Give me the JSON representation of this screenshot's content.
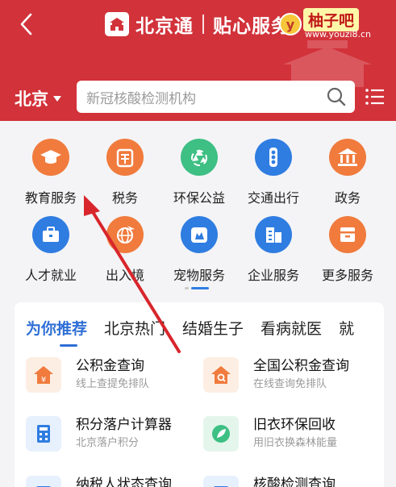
{
  "header": {
    "app_name": "北京通",
    "subtitle": "贴心服务",
    "city": "北京",
    "search_placeholder": "新冠核酸检测机构"
  },
  "watermark": {
    "badge": "y",
    "name": "柚子吧",
    "url": "www.youzi8.cn"
  },
  "grid": {
    "row1": [
      {
        "label": "教育服务",
        "icon": "graduation-cap-icon",
        "color": "#f07b3d"
      },
      {
        "label": "税务",
        "icon": "tax-icon",
        "color": "#f07b3d"
      },
      {
        "label": "环保公益",
        "icon": "recycle-icon",
        "color": "#3ebf84"
      },
      {
        "label": "交通出行",
        "icon": "traffic-light-icon",
        "color": "#2f7de1"
      },
      {
        "label": "政务",
        "icon": "government-icon",
        "color": "#f07b3d"
      }
    ],
    "row2": [
      {
        "label": "人才就业",
        "icon": "briefcase-icon",
        "color": "#2f7de1"
      },
      {
        "label": "出入境",
        "icon": "globe-plane-icon",
        "color": "#f07b3d"
      },
      {
        "label": "宠物服务",
        "icon": "pet-icon",
        "color": "#2f7de1"
      },
      {
        "label": "企业服务",
        "icon": "building-icon",
        "color": "#2f7de1"
      },
      {
        "label": "更多服务",
        "icon": "more-icon",
        "color": "#f07b3d"
      }
    ]
  },
  "tabs": [
    "为你推荐",
    "北京热门",
    "结婚生子",
    "看病就医",
    "就"
  ],
  "services": [
    {
      "title": "公积金查询",
      "sub": "线上查提免排队",
      "icon": "housing-fund-icon",
      "color": "#fdeee3"
    },
    {
      "title": "全国公积金查询",
      "sub": "在线查询免排队",
      "icon": "house-search-icon",
      "color": "#fdeee3"
    },
    {
      "title": "积分落户计算器",
      "sub": "北京落户积分",
      "icon": "calculator-icon",
      "color": "#e7f0fd"
    },
    {
      "title": "旧衣环保回收",
      "sub": "用旧衣换森林能量",
      "icon": "leaf-icon",
      "color": "#e4f6ec"
    },
    {
      "title": "纳税人状态查询",
      "sub": "",
      "icon": "tax-status-icon",
      "color": "#e7f0fd"
    },
    {
      "title": "核酸检测查询",
      "sub": "",
      "icon": "test-icon",
      "color": "#e7f0fd"
    }
  ],
  "colors": {
    "header_bg": "#d2323a",
    "accent_blue": "#2f6fd6",
    "orange": "#f07b3d",
    "green": "#3ebf84",
    "annotation_arrow": "#d8262c"
  }
}
